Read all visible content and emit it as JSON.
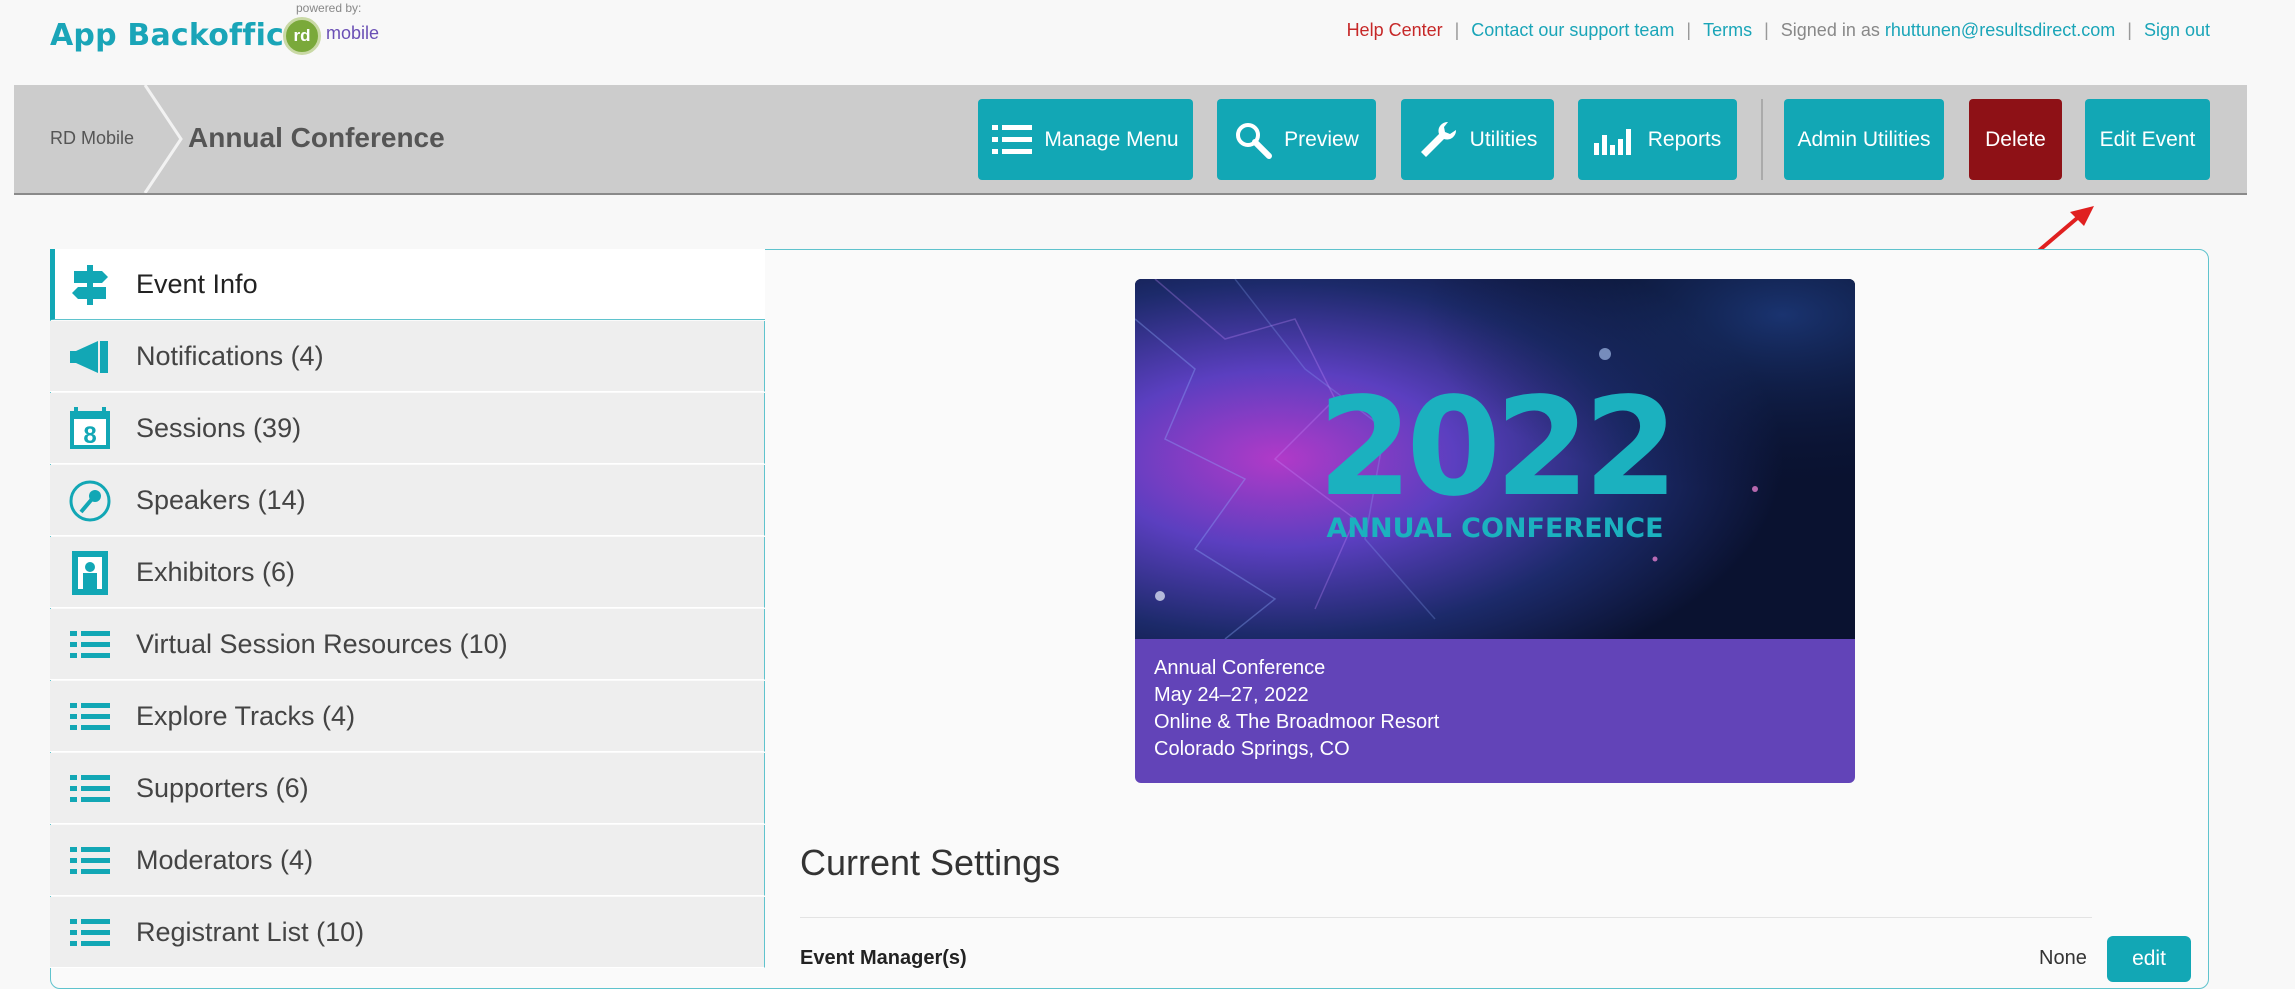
{
  "brand": {
    "app_name": "App Backoffice",
    "powered_by": "powered by:",
    "rd": "rd",
    "mobile": "mobile"
  },
  "top_links": {
    "help": "Help Center",
    "contact": "Contact our support team",
    "terms": "Terms",
    "signed_in_prefix": "Signed in as",
    "email": "rhuttunen@resultsdirect.com",
    "sign_out": "Sign out"
  },
  "header": {
    "breadcrumb_root": "RD Mobile",
    "title": "Annual Conference",
    "buttons": {
      "manage_menu": "Manage Menu",
      "preview": "Preview",
      "utilities": "Utilities",
      "reports": "Reports",
      "admin_utilities": "Admin Utilities",
      "delete": "Delete",
      "edit_event": "Edit Event"
    }
  },
  "sidebar": {
    "items": [
      {
        "label": "Event Info",
        "icon": "signpost-icon"
      },
      {
        "label": "Notifications (4)",
        "icon": "megaphone-icon"
      },
      {
        "label": "Sessions (39)",
        "icon": "calendar-icon"
      },
      {
        "label": "Speakers (14)",
        "icon": "microphone-icon"
      },
      {
        "label": "Exhibitors (6)",
        "icon": "booth-icon"
      },
      {
        "label": "Virtual Session Resources (10)",
        "icon": "list-icon"
      },
      {
        "label": "Explore Tracks (4)",
        "icon": "list-icon"
      },
      {
        "label": "Supporters (6)",
        "icon": "list-icon"
      },
      {
        "label": "Moderators (4)",
        "icon": "list-icon"
      },
      {
        "label": "Registrant List (10)",
        "icon": "list-icon"
      }
    ]
  },
  "event_card": {
    "banner_year": "2022",
    "banner_subtitle": "ANNUAL CONFERENCE",
    "name": "Annual Conference",
    "dates": "May 24–27, 2022",
    "venue": "Online & The Broadmoor Resort",
    "location": "Colorado Springs, CO"
  },
  "settings": {
    "title": "Current Settings",
    "event_manager_label": "Event Manager(s)",
    "event_manager_value": "None",
    "edit_label": "edit"
  },
  "colors": {
    "teal": "#12a7b5",
    "delete_red": "#8e1116",
    "card_purple": "#6244b8",
    "help_red": "#c62828"
  }
}
